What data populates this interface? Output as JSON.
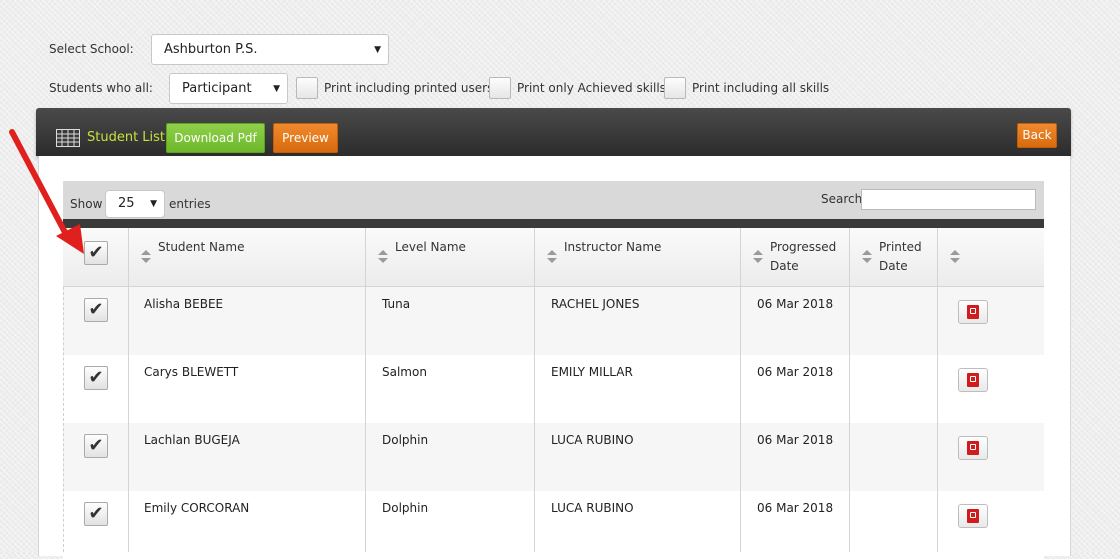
{
  "filters": {
    "school_label": "Select School:",
    "school_value": "Ashburton P.S.",
    "students_label": "Students who all:",
    "students_value": "Participant",
    "options": [
      "Print including printed users",
      "Print only Achieved skills",
      "Print including all skills"
    ]
  },
  "header": {
    "title": "Student List",
    "download_label": "Download Pdf",
    "preview_label": "Preview",
    "back_label": "Back",
    "accent_color": "#c8e03c"
  },
  "table_tools": {
    "show_label": "Show",
    "entries_value": "25",
    "entries_label": "entries",
    "search_label": "Search:",
    "search_value": ""
  },
  "columns": {
    "student": "Student Name",
    "level": "Level Name",
    "instructor": "Instructor Name",
    "progressed_1": "Progressed",
    "progressed_2": "Date",
    "printed_1": "Printed",
    "printed_2": "Date"
  },
  "rows": [
    {
      "student": "Alisha BEBEE",
      "level": "Tuna",
      "instructor": "RACHEL JONES",
      "progressed": "06 Mar 2018",
      "printed": "",
      "checked": true
    },
    {
      "student": "Carys BLEWETT",
      "level": "Salmon",
      "instructor": "EMILY MILLAR",
      "progressed": "06 Mar 2018",
      "printed": "",
      "checked": true
    },
    {
      "student": "Lachlan BUGEJA",
      "level": "Dolphin",
      "instructor": "LUCA RUBINO",
      "progressed": "06 Mar 2018",
      "printed": "",
      "checked": true
    },
    {
      "student": "Emily CORCORAN",
      "level": "Dolphin",
      "instructor": "LUCA RUBINO",
      "progressed": "06 Mar 2018",
      "printed": "",
      "checked": true
    }
  ],
  "icons": {
    "check": "✔",
    "select_caret": "▼",
    "annotation": "red-arrow",
    "pdf": "pdf-icon"
  }
}
